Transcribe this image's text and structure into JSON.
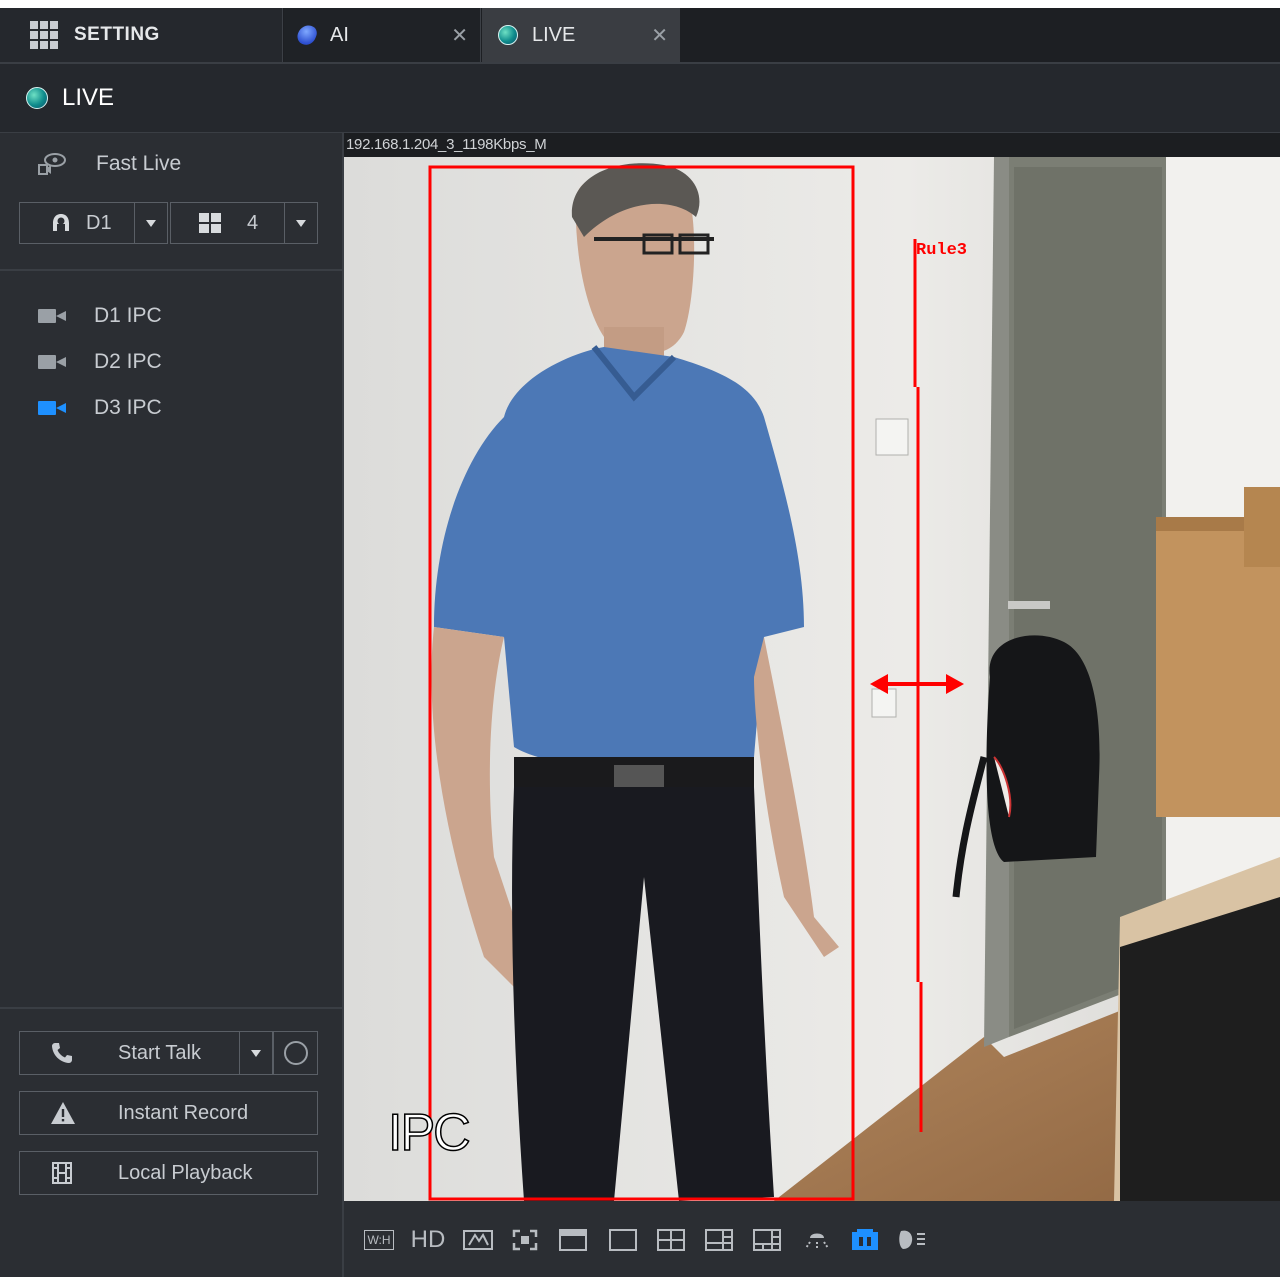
{
  "tabs": {
    "setting": {
      "label": "SETTING"
    },
    "ai": {
      "label": "AI"
    },
    "live": {
      "label": "LIVE"
    }
  },
  "live_header": {
    "title": "LIVE"
  },
  "sidebar": {
    "fast_live": "Fast Live",
    "channel_selector": {
      "value": "D1"
    },
    "layout_selector": {
      "value": "4"
    },
    "devices": [
      {
        "label": "D1 IPC",
        "active": false
      },
      {
        "label": "D2 IPC",
        "active": false
      },
      {
        "label": "D3 IPC",
        "active": true
      }
    ],
    "buttons": {
      "start_talk": "Start Talk",
      "instant_record": "Instant Record",
      "local_playback": "Local Playback"
    }
  },
  "video": {
    "stream_info": "192.168.1.204_3_1198Kbps_M",
    "osd_name": "IPC",
    "rule_label": "Rule3"
  },
  "toolbar": {
    "aspect_label": "W:H",
    "quality_label": "HD"
  },
  "colors": {
    "accent_blue": "#1e90ff",
    "rule_red": "#ff0000",
    "panel_bg": "#2b2e33",
    "tabbar_bg": "#1d1f23"
  }
}
